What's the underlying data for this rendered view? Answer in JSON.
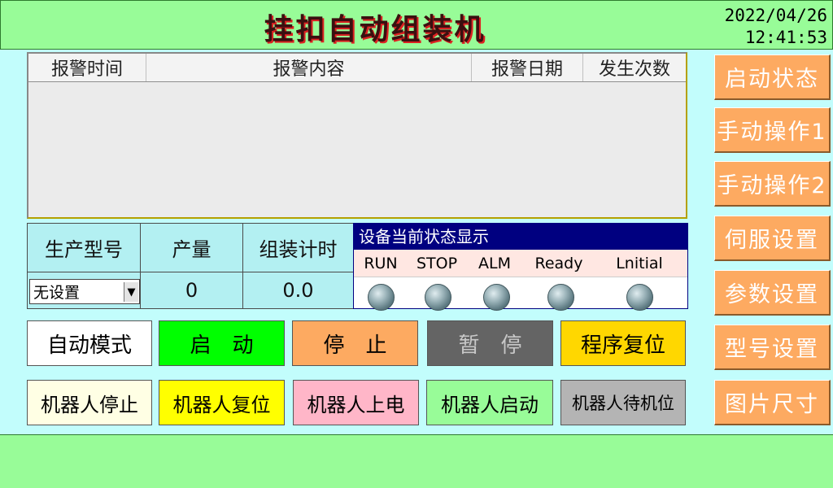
{
  "header": {
    "title": "挂扣自动组装机",
    "date": "2022/04/26",
    "time": "12:41:53"
  },
  "alarm_table": {
    "columns": [
      "报警时间",
      "报警内容",
      "报警日期",
      "发生次数"
    ],
    "rows": []
  },
  "production": {
    "model_label": "生产型号",
    "output_label": "产量",
    "timer_label": "组装计时",
    "model_value": "无设置",
    "output_value": "0",
    "timer_value": "0.0"
  },
  "status": {
    "title": "设备当前状态显示",
    "labels": [
      "RUN",
      "STOP",
      "ALM",
      "Ready",
      "Lnitial"
    ]
  },
  "controls": {
    "auto_mode": "自动模式",
    "start": "启　动",
    "stop": "停　止",
    "pause": "暂　停",
    "program_reset": "程序复位",
    "robot_stop": "机器人停止",
    "robot_reset": "机器人复位",
    "robot_power_on": "机器人上电",
    "robot_start": "机器人启动",
    "robot_standby": "机器人待机位"
  },
  "side_menu": [
    "启动状态",
    "手动操作1",
    "手动操作2",
    "伺服设置",
    "参数设置",
    "型号设置",
    "图片尺寸"
  ],
  "colors": {
    "header_bg": "#98fc98",
    "body_bg": "#c2fdfc",
    "start_btn": "#00ff00",
    "stop_btn": "#fdaa61",
    "pause_btn": "#646464",
    "reset_btn": "#ffd700",
    "side_btn": "#fdaa61",
    "status_title_bg": "#000080"
  }
}
